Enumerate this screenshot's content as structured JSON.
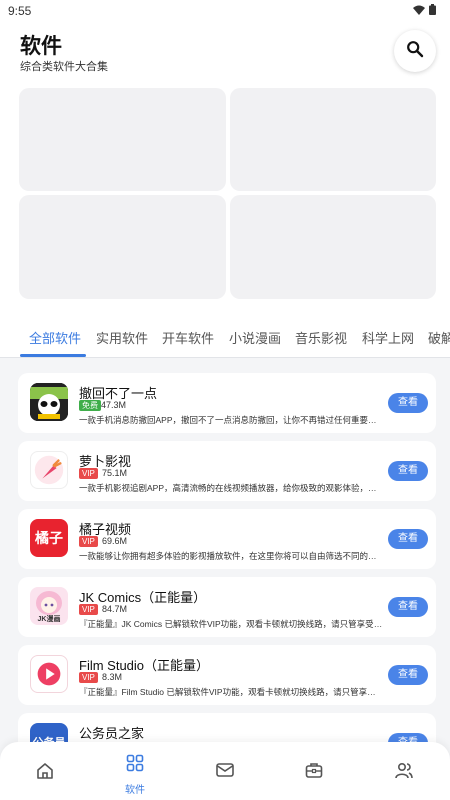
{
  "status": {
    "time": "9:55"
  },
  "header": {
    "title": "软件",
    "subtitle": "综合类软件大合集"
  },
  "tabs": [
    {
      "label": "全部软件",
      "active": true
    },
    {
      "label": "实用软件",
      "active": false
    },
    {
      "label": "开车软件",
      "active": false
    },
    {
      "label": "小说漫画",
      "active": false
    },
    {
      "label": "音乐影视",
      "active": false
    },
    {
      "label": "科学上网",
      "active": false
    },
    {
      "label": "破解",
      "active": false
    }
  ],
  "apps": [
    {
      "name": "撤回不了一点",
      "badge": "免费",
      "badge_color": "#3fae4a",
      "size": "47.3M",
      "desc": "一款手机消息防撤回APP，撤回不了一点消息防撤回，让你不再错过任何重要信息...",
      "icon": "panda-icon"
    },
    {
      "name": "萝卜影视",
      "badge": "VIP",
      "badge_color": "#e84a4a",
      "size": "75.1M",
      "desc": "一款手机影视追剧APP，高清流畅的在线视频播放器，给你极致的观影体验，海量...",
      "icon": "carrot-icon"
    },
    {
      "name": "橘子视频",
      "badge": "VIP",
      "badge_color": "#e84a4a",
      "size": "69.6M",
      "desc": "一款能够让你拥有超多体验的影视播放软件，在这里你将可以自由筛选不同的资源...",
      "icon": "orange-text-icon",
      "icon_text": "橘子"
    },
    {
      "name": "JK Comics（正能量）",
      "badge": "VIP",
      "badge_color": "#e84a4a",
      "size": "84.7M",
      "desc": "『正能量』JK Comics 已解锁软件VIP功能，观看卡顿就切换线路，请只管享受软...",
      "icon": "anime-girl-icon",
      "icon_text": "JK漫画"
    },
    {
      "name": "Film Studio（正能量）",
      "badge": "VIP",
      "badge_color": "#e84a4a",
      "size": "8.3M",
      "desc": "『正能量』Film Studio 已解锁软件VIP功能，观看卡顿就切换线路，请只管享受软...",
      "icon": "play-icon"
    },
    {
      "name": "公务员之家",
      "badge": "",
      "badge_color": "#3fae4a",
      "size": "",
      "desc": "",
      "icon": "civil-text-icon",
      "icon_text": "公务员"
    }
  ],
  "view_label": "查看",
  "bottom_nav": [
    {
      "icon": "home-icon",
      "label": ""
    },
    {
      "icon": "grid-icon",
      "label": "软件"
    },
    {
      "icon": "mail-icon",
      "label": ""
    },
    {
      "icon": "toolbox-icon",
      "label": ""
    },
    {
      "icon": "users-icon",
      "label": ""
    }
  ],
  "colors": {
    "accent": "#3b7be0",
    "button": "#4a84e8",
    "vip": "#e84a4a",
    "free": "#3fae4a"
  }
}
